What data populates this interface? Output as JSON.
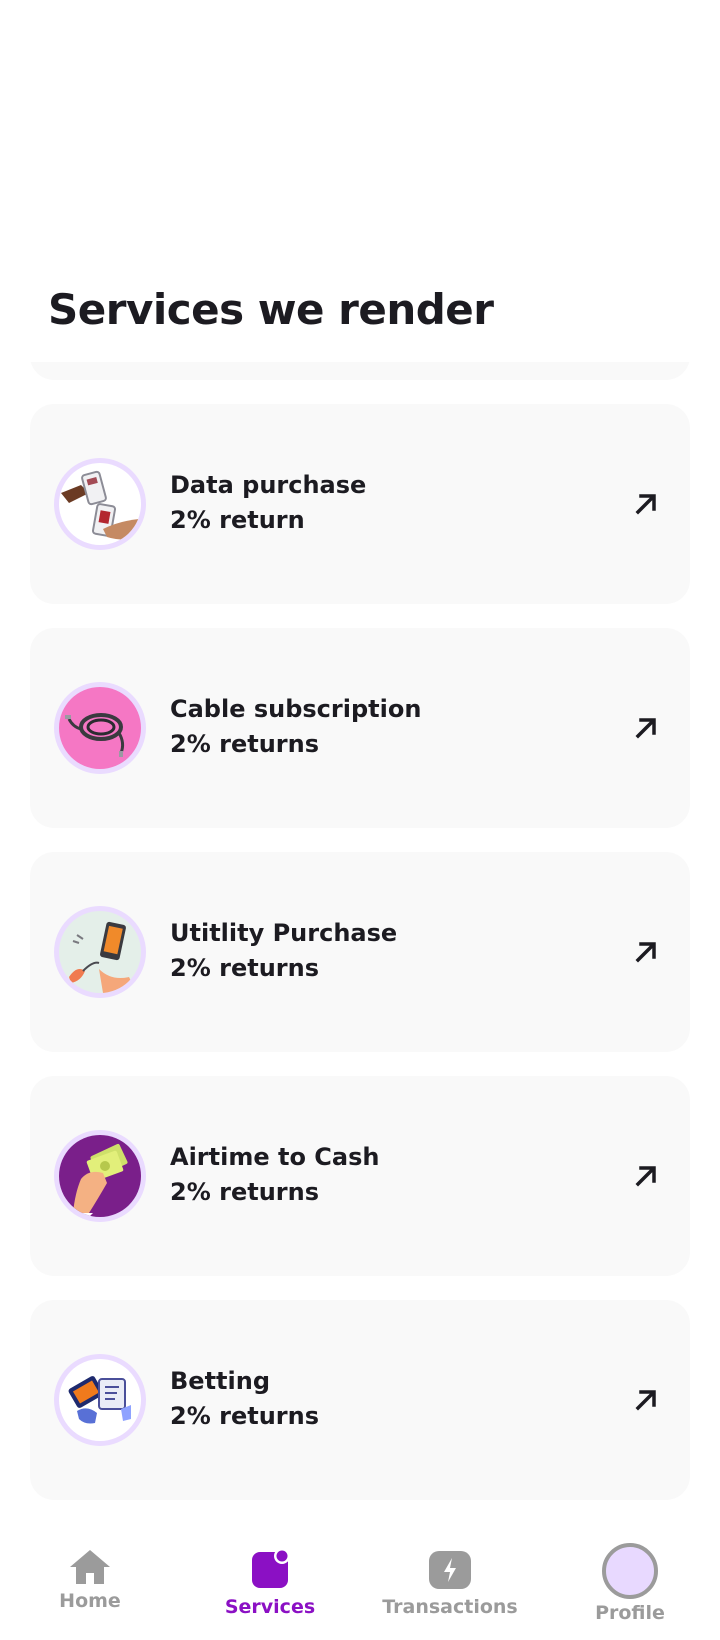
{
  "page": {
    "title": "Services we render"
  },
  "services": [
    {
      "name": "",
      "return_text": "",
      "image": "hidden-service-image"
    },
    {
      "name": "Data purchase",
      "return_text": "2% return",
      "image": "data-purchase-image"
    },
    {
      "name": "Cable subscription",
      "return_text": "2% returns",
      "image": "cable-image"
    },
    {
      "name": "Utitlity Purchase",
      "return_text": "2% returns",
      "image": "utility-image"
    },
    {
      "name": "Airtime to Cash",
      "return_text": "2% returns",
      "image": "airtime-cash-image"
    },
    {
      "name": "Betting",
      "return_text": "2% returns",
      "image": "betting-image"
    }
  ],
  "bottom_nav": {
    "active": "services",
    "items": [
      {
        "id": "home",
        "label": "Home",
        "icon": "home-icon"
      },
      {
        "id": "services",
        "label": "Services",
        "icon": "services-icon"
      },
      {
        "id": "transactions",
        "label": "Transactions",
        "icon": "lightning-icon"
      },
      {
        "id": "profile",
        "label": "Profile",
        "icon": "profile-avatar-icon"
      }
    ]
  },
  "colors": {
    "accent": "#8b10c4",
    "card_background": "#f9f9f9",
    "avatar_ring": "#eadbff",
    "inactive_nav": "#9b9b9b",
    "text": "#1c1b21"
  }
}
